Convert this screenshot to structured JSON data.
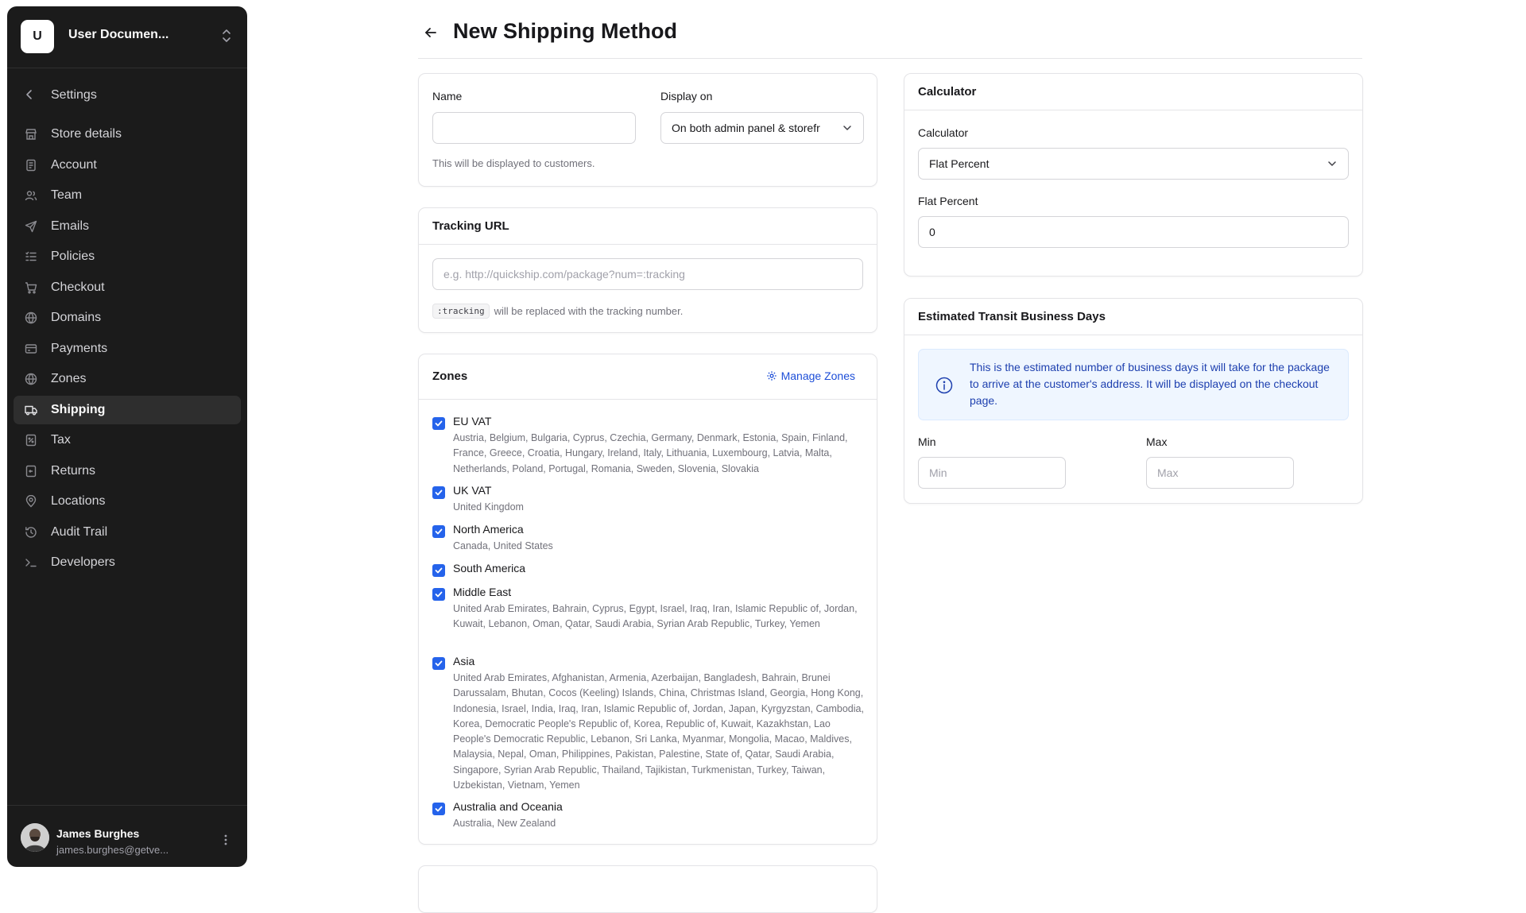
{
  "org": {
    "initial": "U",
    "name": "User Documen..."
  },
  "nav_back": "Settings",
  "nav": [
    {
      "label": "Store details",
      "icon": "store-icon",
      "active": false
    },
    {
      "label": "Account",
      "icon": "account-icon",
      "active": false
    },
    {
      "label": "Team",
      "icon": "team-icon",
      "active": false
    },
    {
      "label": "Emails",
      "icon": "send-icon",
      "active": false
    },
    {
      "label": "Policies",
      "icon": "list-icon",
      "active": false
    },
    {
      "label": "Checkout",
      "icon": "cart-icon",
      "active": false
    },
    {
      "label": "Domains",
      "icon": "globe-icon",
      "active": false
    },
    {
      "label": "Payments",
      "icon": "card-icon",
      "active": false
    },
    {
      "label": "Zones",
      "icon": "globe-icon",
      "active": false
    },
    {
      "label": "Shipping",
      "icon": "truck-icon",
      "active": true
    },
    {
      "label": "Tax",
      "icon": "percent-icon",
      "active": false
    },
    {
      "label": "Returns",
      "icon": "return-icon",
      "active": false
    },
    {
      "label": "Locations",
      "icon": "pin-icon",
      "active": false
    },
    {
      "label": "Audit Trail",
      "icon": "history-icon",
      "active": false
    },
    {
      "label": "Developers",
      "icon": "terminal-icon",
      "active": false
    }
  ],
  "user": {
    "name": "James Burghes",
    "email": "james.burghes@getve..."
  },
  "page_title": "New Shipping Method",
  "basic": {
    "name_label": "Name",
    "name_value": "",
    "display_label": "Display on",
    "display_value": "On both admin panel & storefr",
    "hint": "This will be displayed to customers."
  },
  "tracking": {
    "title": "Tracking URL",
    "placeholder": "e.g. http://quickship.com/package?num=:tracking",
    "code": ":tracking",
    "hint": "will be replaced with the tracking number."
  },
  "zones": {
    "title": "Zones",
    "manage_label": "Manage Zones",
    "items": [
      {
        "name": "EU VAT",
        "countries": "Austria, Belgium, Bulgaria, Cyprus, Czechia, Germany, Denmark, Estonia, Spain, Finland, France, Greece, Croatia, Hungary, Ireland, Italy, Lithuania, Luxembourg, Latvia, Malta, Netherlands, Poland, Portugal, Romania, Sweden, Slovenia, Slovakia",
        "checked": true
      },
      {
        "name": "UK VAT",
        "countries": "United Kingdom",
        "checked": true
      },
      {
        "name": "North America",
        "countries": "Canada, United States",
        "checked": true
      },
      {
        "name": "South America",
        "countries": "",
        "checked": true
      },
      {
        "name": "Middle East",
        "countries": "United Arab Emirates, Bahrain, Cyprus, Egypt, Israel, Iraq, Iran, Islamic Republic of, Jordan, Kuwait, Lebanon, Oman, Qatar, Saudi Arabia, Syrian Arab Republic, Turkey, Yemen",
        "checked": true
      },
      {
        "name": "Asia",
        "countries": "United Arab Emirates, Afghanistan, Armenia, Azerbaijan, Bangladesh, Bahrain, Brunei Darussalam, Bhutan, Cocos (Keeling) Islands, China, Christmas Island, Georgia, Hong Kong, Indonesia, Israel, India, Iraq, Iran, Islamic Republic of, Jordan, Japan, Kyrgyzstan, Cambodia, Korea, Democratic People's Republic of, Korea, Republic of, Kuwait, Kazakhstan, Lao People's Democratic Republic, Lebanon, Sri Lanka, Myanmar, Mongolia, Macao, Maldives, Malaysia, Nepal, Oman, Philippines, Pakistan, Palestine, State of, Qatar, Saudi Arabia, Singapore, Syrian Arab Republic, Thailand, Tajikistan, Turkmenistan, Turkey, Taiwan, Uzbekistan, Vietnam, Yemen",
        "checked": true
      },
      {
        "name": "Australia and Oceania",
        "countries": "Australia, New Zealand",
        "checked": true
      }
    ]
  },
  "calculator": {
    "title": "Calculator",
    "label": "Calculator",
    "value": "Flat Percent",
    "percent_label": "Flat Percent",
    "percent_value": "0"
  },
  "transit": {
    "title": "Estimated Transit Business Days",
    "info": "This is the estimated number of business days it will take for the package to arrive at the customer's address. It will be displayed on the checkout page.",
    "min_label": "Min",
    "min_placeholder": "Min",
    "max_label": "Max",
    "max_placeholder": "Max"
  },
  "colors": {
    "accent": "#2563eb",
    "sidebar_bg": "#1b1b1b",
    "info_bg": "#eff6ff"
  }
}
